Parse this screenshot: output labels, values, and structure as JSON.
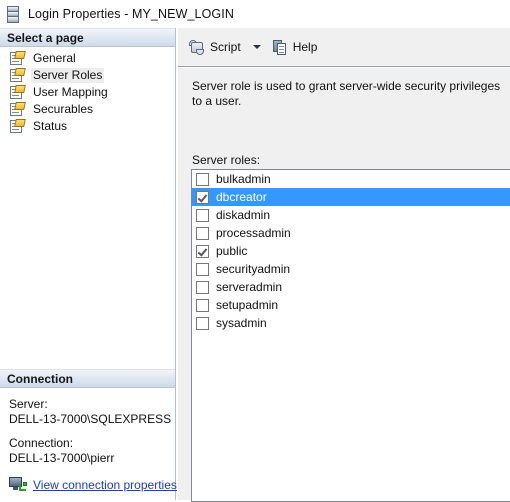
{
  "window": {
    "title": "Login Properties - MY_NEW_LOGIN",
    "icon": "server-icon"
  },
  "sidebar": {
    "header": "Select a page",
    "items": [
      {
        "label": "General",
        "icon": "page-icon",
        "selected": false
      },
      {
        "label": "Server Roles",
        "icon": "page-icon",
        "selected": true
      },
      {
        "label": "User Mapping",
        "icon": "page-icon",
        "selected": false
      },
      {
        "label": "Securables",
        "icon": "page-icon",
        "selected": false
      },
      {
        "label": "Status",
        "icon": "page-icon",
        "selected": false
      }
    ]
  },
  "connection": {
    "header": "Connection",
    "server_label": "Server:",
    "server_value": "DELL-13-7000\\SQLEXPRESS",
    "connection_label": "Connection:",
    "connection_value": "DELL-13-7000\\pierr",
    "link_label": "View connection properties",
    "link_icon": "network-connection-icon",
    "link_color": "#1a3fbb"
  },
  "toolbar": {
    "script_label": "Script",
    "script_icon": "script-scroll-icon",
    "dropdown_icon": "chevron-down-icon",
    "help_label": "Help",
    "help_icon": "help-pages-icon"
  },
  "main": {
    "description": "Server role is used to grant server-wide security privileges to a user.",
    "roles_label": "Server roles:",
    "selection_color": "#3399ff",
    "roles": [
      {
        "name": "bulkadmin",
        "checked": false,
        "selected": false
      },
      {
        "name": "dbcreator",
        "checked": true,
        "selected": true
      },
      {
        "name": "diskadmin",
        "checked": false,
        "selected": false
      },
      {
        "name": "processadmin",
        "checked": false,
        "selected": false
      },
      {
        "name": "public",
        "checked": true,
        "selected": false
      },
      {
        "name": "securityadmin",
        "checked": false,
        "selected": false
      },
      {
        "name": "serveradmin",
        "checked": false,
        "selected": false
      },
      {
        "name": "setupadmin",
        "checked": false,
        "selected": false
      },
      {
        "name": "sysadmin",
        "checked": false,
        "selected": false
      }
    ]
  }
}
